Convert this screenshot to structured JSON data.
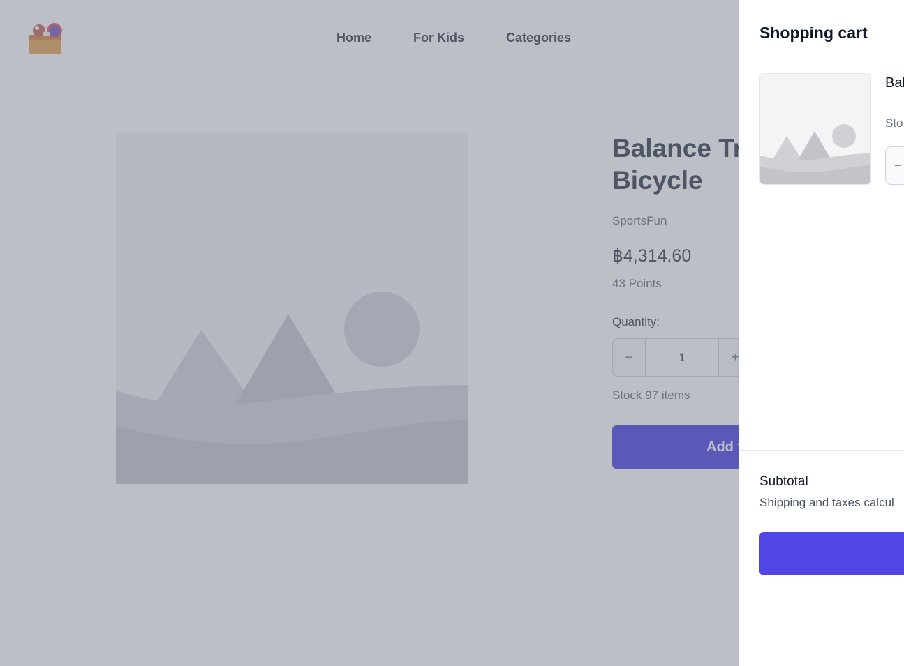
{
  "header": {
    "logo_icon": "toy-box-logo-icon",
    "nav": [
      {
        "label": "Home"
      },
      {
        "label": "For Kids"
      },
      {
        "label": "Categories"
      }
    ]
  },
  "product": {
    "image_icon": "image-placeholder-icon",
    "title": "Balance Training Bicycle",
    "title_line1": "Balance Tr",
    "title_line2": "Bicycle",
    "brand": "SportsFun",
    "price": "฿4,314.60",
    "points": "43 Points",
    "quantity_label": "Quantity:",
    "quantity_value": "1",
    "decrement_symbol": "−",
    "increment_symbol": "+",
    "stock_text": "Stock 97 items",
    "add_button_label": "Add t"
  },
  "cart": {
    "title": "Shopping cart",
    "items": [
      {
        "image_icon": "image-placeholder-icon",
        "name": "Bal",
        "stock": "Sto",
        "decrement_symbol": "−"
      }
    ],
    "subtotal_label": "Subtotal",
    "shipping_note": "Shipping and taxes calcul",
    "checkout_label": ""
  },
  "colors": {
    "accent": "#4f46e5",
    "overlay": "rgba(107,114,128,0.45)"
  }
}
